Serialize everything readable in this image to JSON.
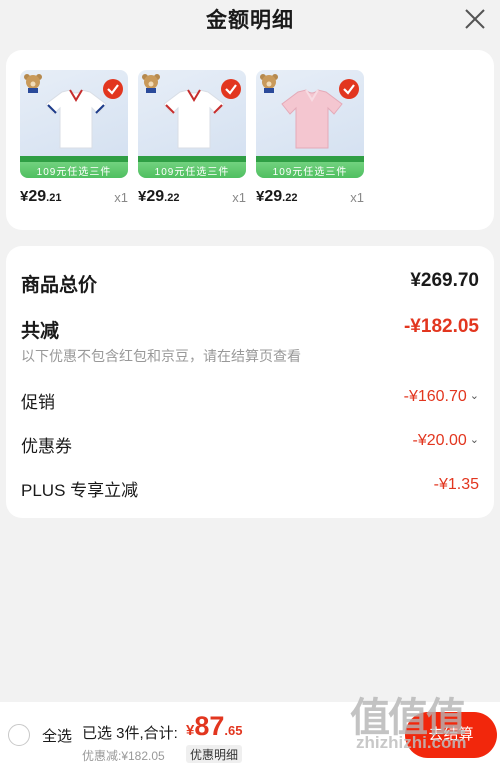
{
  "header": {
    "title": "金额明细"
  },
  "products": [
    {
      "price_int": "29",
      "price_dec": ".21",
      "qty": "x1",
      "promo": "109元任选三件",
      "color": "#ffffff"
    },
    {
      "price_int": "29",
      "price_dec": ".22",
      "qty": "x1",
      "promo": "109元任选三件",
      "color": "#ffffff"
    },
    {
      "price_int": "29",
      "price_dec": ".22",
      "qty": "x1",
      "promo": "109元任选三件",
      "color": "#f4c6d0"
    }
  ],
  "currency": "¥",
  "summary": {
    "total_label": "商品总价",
    "total_value": "¥269.70",
    "reduce_label": "共减",
    "reduce_value": "-¥182.05",
    "note": "以下优惠不包含红包和京豆，请在结算页查看",
    "items": [
      {
        "label": "促销",
        "value": "-¥160.70"
      },
      {
        "label": "优惠券",
        "value": "-¥20.00"
      },
      {
        "label": "PLUS 专享立减",
        "value": "-¥1.35"
      }
    ]
  },
  "bottom": {
    "select_all": "全选",
    "selected": "已选 3件,合计:",
    "total_int": "87",
    "total_dec": ".65",
    "discount": "优惠减:¥182.05",
    "detail": "优惠明细",
    "checkout": "去结算"
  },
  "watermark": {
    "big": "值值值",
    "small": "zhizhizhi.com"
  },
  "colors": {
    "accent_red": "#e2361f",
    "checkout_red": "#f2270c",
    "background": "#f2f2f2"
  }
}
